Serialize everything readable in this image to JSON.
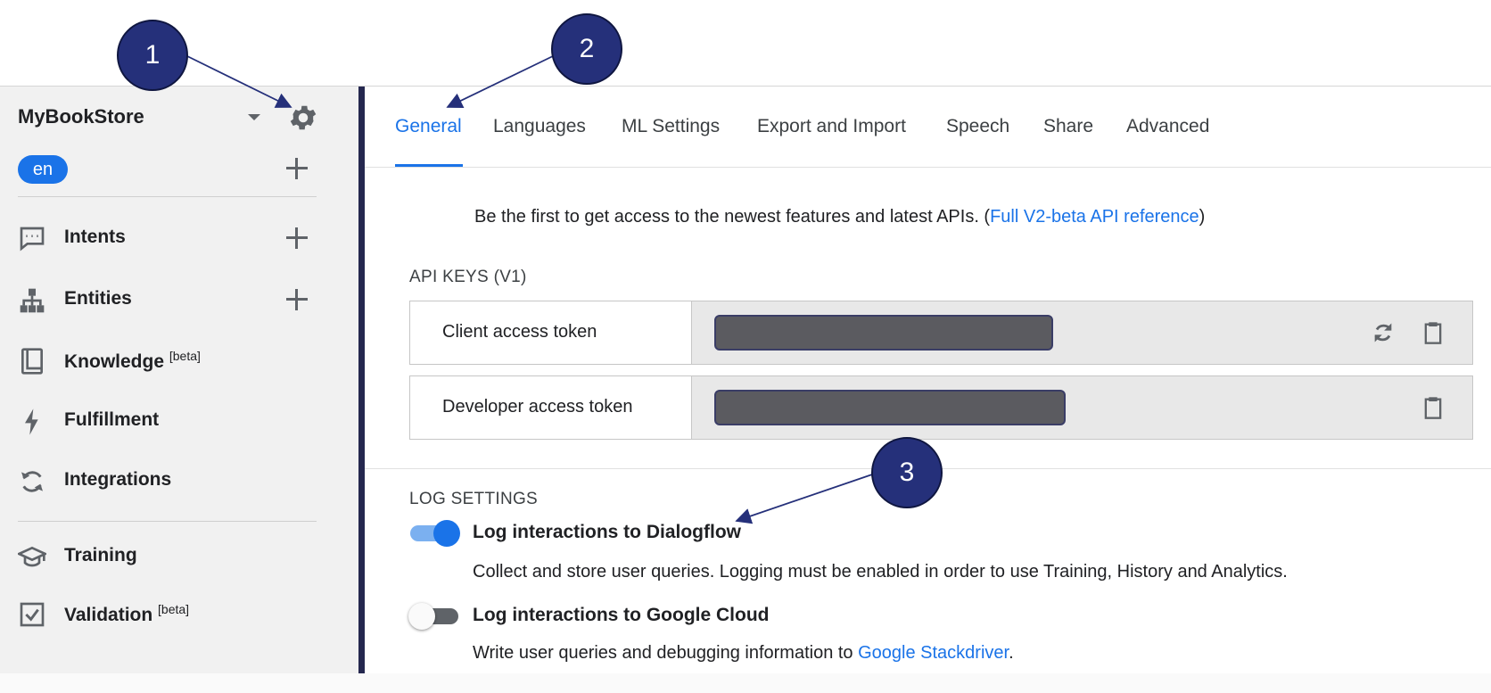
{
  "sidebar": {
    "agent_name": "MyBookStore",
    "language": "en",
    "items": [
      {
        "label": "Intents",
        "sup": "",
        "icon": "chat-bubble-icon"
      },
      {
        "label": "Entities",
        "sup": "",
        "icon": "hierarchy-icon"
      },
      {
        "label": "Knowledge",
        "sup": "[beta]",
        "icon": "book-icon"
      },
      {
        "label": "Fulfillment",
        "sup": "",
        "icon": "lightning-icon"
      },
      {
        "label": "Integrations",
        "sup": "",
        "icon": "sync-icon"
      },
      {
        "label": "Training",
        "sup": "",
        "icon": "graduation-cap-icon"
      },
      {
        "label": "Validation",
        "sup": "[beta]",
        "icon": "checkbox-icon"
      }
    ]
  },
  "tabs": [
    "General",
    "Languages",
    "ML Settings",
    "Export and Import",
    "Speech",
    "Share",
    "Advanced"
  ],
  "active_tab": "General",
  "promo": {
    "text": "Be the first to get access to the newest features and latest APIs. (",
    "link": "Full V2-beta API reference",
    "suffix": ")"
  },
  "api_keys": {
    "title": "API KEYS (V1)",
    "client_label": "Client access token",
    "developer_label": "Developer access token"
  },
  "log_settings": {
    "title": "LOG SETTINGS",
    "dialogflow": {
      "title": "Log interactions to Dialogflow",
      "desc": "Collect and store user queries. Logging must be enabled in order to use Training, History and Analytics.",
      "enabled": true
    },
    "cloud": {
      "title": "Log interactions to Google Cloud",
      "desc_prefix": "Write user queries and debugging information to ",
      "desc_link": "Google Stackdriver",
      "desc_suffix": ".",
      "enabled": false
    }
  },
  "callouts": [
    "1",
    "2",
    "3"
  ],
  "colors": {
    "accent": "#1a73e8",
    "callout": "#25307a",
    "sidebar_bg": "#f1f1f1"
  }
}
